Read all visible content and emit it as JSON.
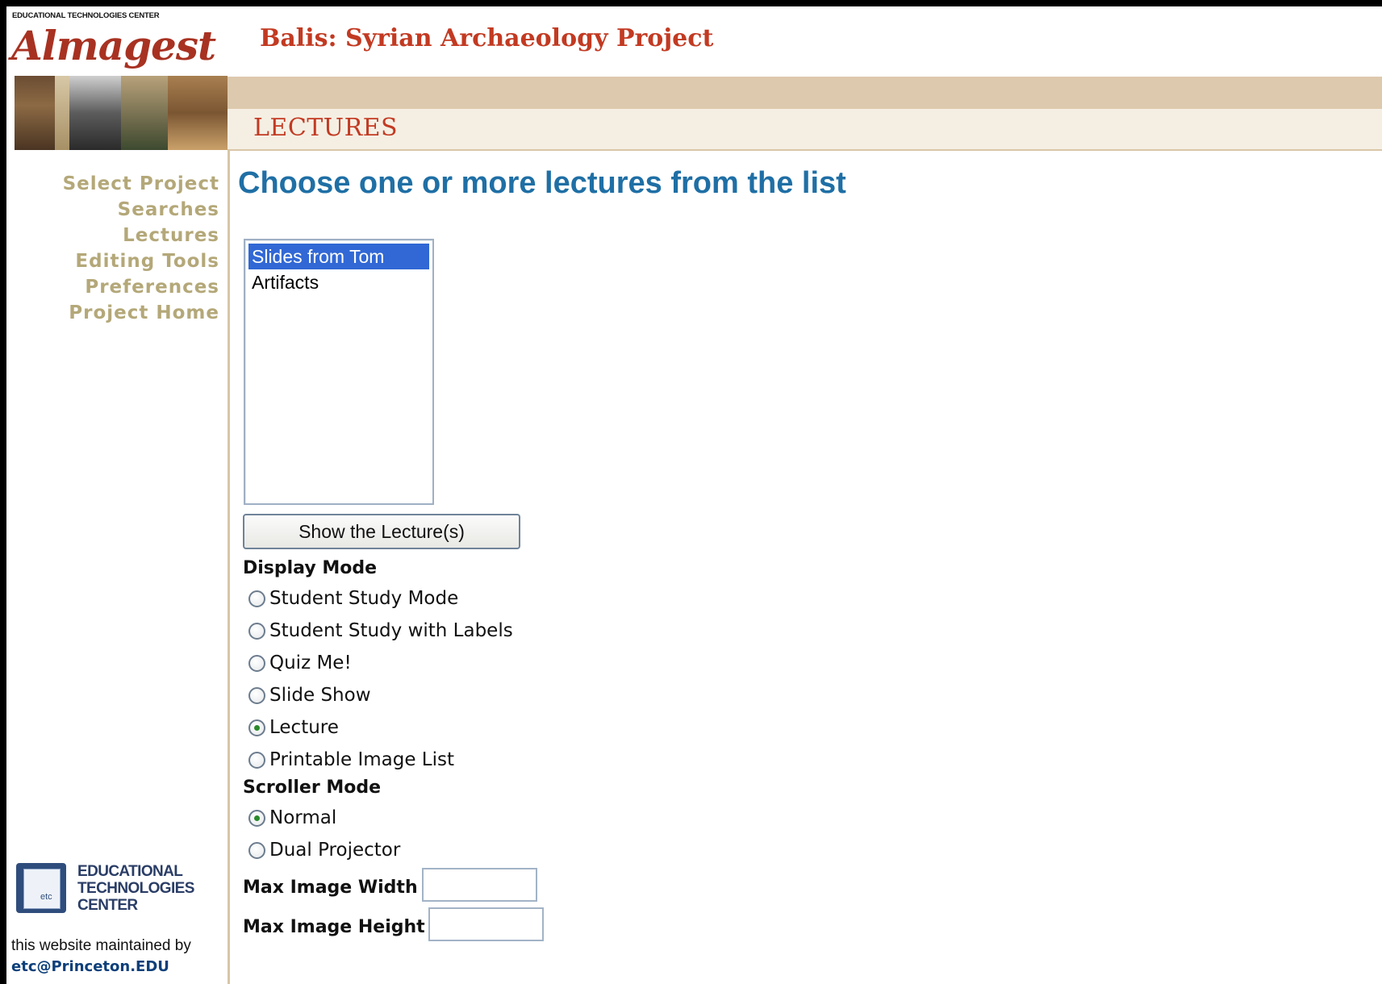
{
  "header": {
    "org_small": "EDUCATIONAL TECHNOLOGIES CENTER",
    "logo_text": "Almagest",
    "site_title": "Balis: Syrian Archaeology Project",
    "section_title": "LECTURES"
  },
  "nav": {
    "items": [
      {
        "label": "Select Project"
      },
      {
        "label": "Searches"
      },
      {
        "label": "Lectures"
      },
      {
        "label": "Editing Tools"
      },
      {
        "label": "Preferences"
      },
      {
        "label": "Project Home"
      }
    ]
  },
  "footer": {
    "etc_box_text": "etc",
    "etc_line1": "EDUCATIONAL",
    "etc_line2": "TECHNOLOGIES",
    "etc_line3": "CENTER",
    "maintained_by": "this website maintained by",
    "email": "etc@Princeton.EDU"
  },
  "main": {
    "heading": "Choose one or more lectures from the list",
    "lectures": [
      {
        "label": "Slides from Tom",
        "selected": true
      },
      {
        "label": "Artifacts",
        "selected": false
      }
    ],
    "show_button": "Show the Lecture(s)",
    "display_mode": {
      "label": "Display Mode",
      "options": [
        {
          "label": "Student Study Mode",
          "checked": false
        },
        {
          "label": "Student Study with Labels",
          "checked": false
        },
        {
          "label": "Quiz Me!",
          "checked": false
        },
        {
          "label": "Slide Show",
          "checked": false
        },
        {
          "label": "Lecture",
          "checked": true
        },
        {
          "label": "Printable Image List",
          "checked": false
        }
      ]
    },
    "scroller_mode": {
      "label": "Scroller Mode",
      "options": [
        {
          "label": "Normal",
          "checked": true
        },
        {
          "label": "Dual Projector",
          "checked": false
        }
      ]
    },
    "max_width": {
      "label": "Max Image Width",
      "value": ""
    },
    "max_height": {
      "label": "Max Image Height",
      "value": ""
    }
  },
  "colors": {
    "nav_text": "#b4a879",
    "heading_blue": "#1f6fa5",
    "title_red": "#c23a22",
    "selection_blue": "#3168d5"
  }
}
